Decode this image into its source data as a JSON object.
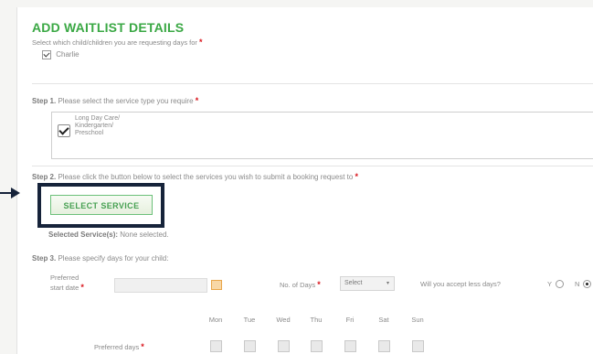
{
  "section": {
    "title": "ADD WAITLIST DETAILS",
    "child_prompt": "Select which child/children you are requesting days for",
    "required_mark": "*",
    "child_name": "Charlie",
    "child_checked": true
  },
  "step1": {
    "label": "Step 1.",
    "text": "Please select the service type you require",
    "service_lines": [
      "Long Day Care/",
      "Kindergarten/",
      "Preschool"
    ],
    "service_checked": true
  },
  "step2": {
    "label": "Step 2.",
    "text": "Please click the button below to select the services you wish to submit a booking request to",
    "button_label": "SELECT SERVICE",
    "selected_label": "Selected Service(s):",
    "selected_value": "None selected."
  },
  "step3": {
    "label": "Step 3.",
    "text": "Please specify days for your child:",
    "start_date_line1": "Preferred",
    "start_date_line2": "start date",
    "start_date_value": "",
    "num_days_label": "No. of Days",
    "num_days_value": "Select",
    "accept_less_label": "Will you accept less days?",
    "yes_label": "Y",
    "no_label": "N",
    "accept_less_value": "N",
    "days": [
      "Mon",
      "Tue",
      "Wed",
      "Thu",
      "Fri",
      "Sat",
      "Sun"
    ],
    "preferred_days_label": "Preferred days"
  },
  "colors": {
    "title_green": "#3aa844",
    "required_red": "#d9141b",
    "highlight_navy": "#16233a",
    "date_icon_orange": "#e9a64a"
  }
}
